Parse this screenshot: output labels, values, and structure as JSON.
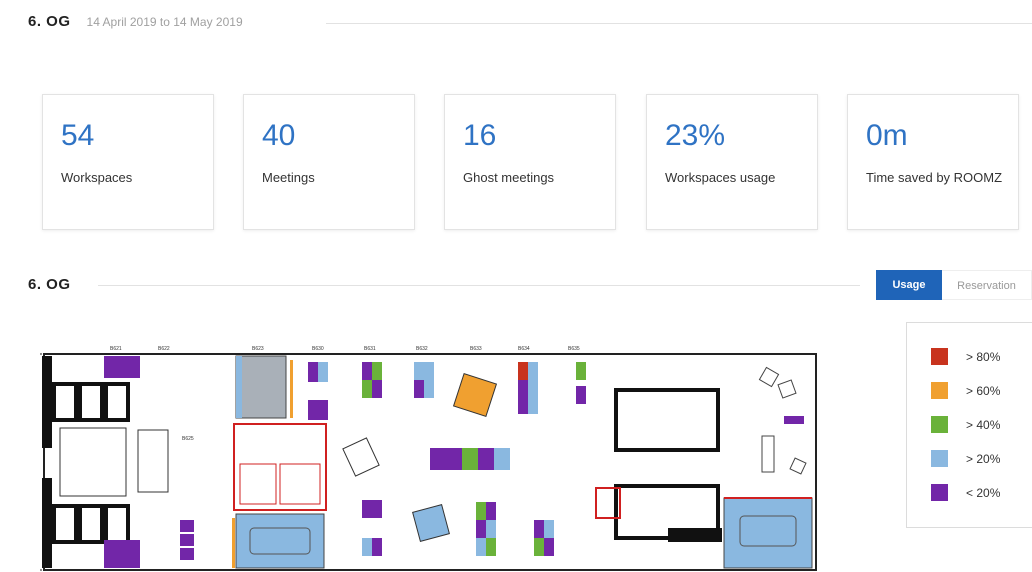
{
  "header": {
    "floor": "6. OG",
    "date_range": "14 April 2019 to 14 May 2019"
  },
  "stats": [
    {
      "value": "54",
      "label": "Workspaces"
    },
    {
      "value": "40",
      "label": "Meetings"
    },
    {
      "value": "16",
      "label": "Ghost meetings"
    },
    {
      "value": "23%",
      "label": "Workspaces usage"
    },
    {
      "value": "0m",
      "label": "Time saved by ROOMZ"
    }
  ],
  "floorplan_section": {
    "title": "6. OG",
    "toggle": {
      "usage": "Usage",
      "reservation": "Reservation",
      "active": "usage"
    }
  },
  "legend": [
    {
      "label": "> 80%",
      "color": "#c8331e"
    },
    {
      "label": "> 60%",
      "color": "#f0a030"
    },
    {
      "label": "> 40%",
      "color": "#6ab23a"
    },
    {
      "label": "> 20%",
      "color": "#8ab8e0"
    },
    {
      "label": "< 20%",
      "color": "#7226a8"
    }
  ],
  "room_labels": [
    "B621",
    "B622",
    "B623",
    "B630",
    "B631",
    "B632",
    "B633",
    "B634",
    "B635",
    "B625"
  ]
}
